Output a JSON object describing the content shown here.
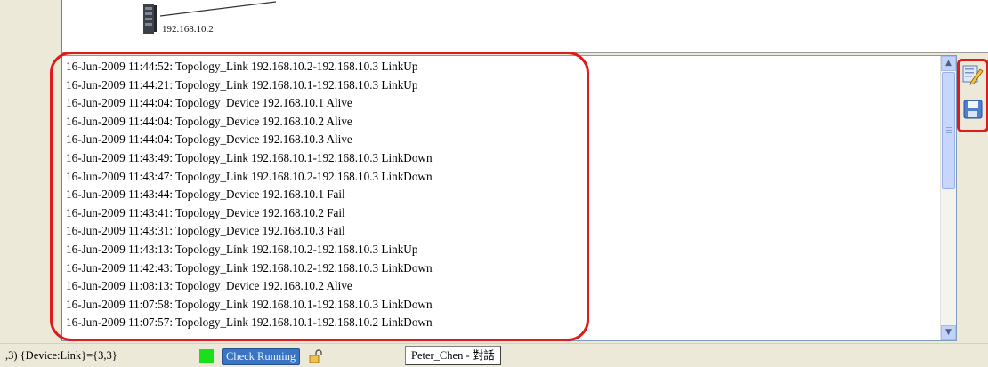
{
  "topology": {
    "device_label": "192.168.10.2"
  },
  "log": {
    "entries": [
      "16-Jun-2009 11:44:52: Topology_Link  192.168.10.2-192.168.10.3 LinkUp",
      "16-Jun-2009 11:44:21: Topology_Link  192.168.10.1-192.168.10.3 LinkUp",
      "16-Jun-2009 11:44:04: Topology_Device 192.168.10.1 Alive",
      "16-Jun-2009 11:44:04: Topology_Device 192.168.10.2 Alive",
      "16-Jun-2009 11:44:04: Topology_Device 192.168.10.3 Alive",
      "16-Jun-2009 11:43:49: Topology_Link  192.168.10.1-192.168.10.3 LinkDown",
      "16-Jun-2009 11:43:47: Topology_Link  192.168.10.2-192.168.10.3 LinkDown",
      "16-Jun-2009 11:43:44: Topology_Device 192.168.10.1 Fail",
      "16-Jun-2009 11:43:41: Topology_Device 192.168.10.2 Fail",
      "16-Jun-2009 11:43:31: Topology_Device 192.168.10.3 Fail",
      "16-Jun-2009 11:43:13: Topology_Link  192.168.10.2-192.168.10.3 LinkUp",
      "16-Jun-2009 11:42:43: Topology_Link  192.168.10.2-192.168.10.3 LinkDown",
      "16-Jun-2009 11:08:13: Topology_Device 192.168.10.2 Alive",
      "16-Jun-2009 11:07:58: Topology_Link  192.168.10.1-192.168.10.3 LinkDown",
      "16-Jun-2009 11:07:57: Topology_Link  192.168.10.1-192.168.10.2 LinkDown"
    ]
  },
  "toolbar": {
    "edit_icon": "edit-log-icon",
    "save_icon": "save-disk-icon"
  },
  "status": {
    "counts_text": ",3)  {Device:Link}={3,3}",
    "check_label": "Check Running",
    "chat_label": "Peter_Chen - 對話",
    "indicator_color": "#19e01a"
  },
  "colors": {
    "highlight": "#e01b1b"
  }
}
